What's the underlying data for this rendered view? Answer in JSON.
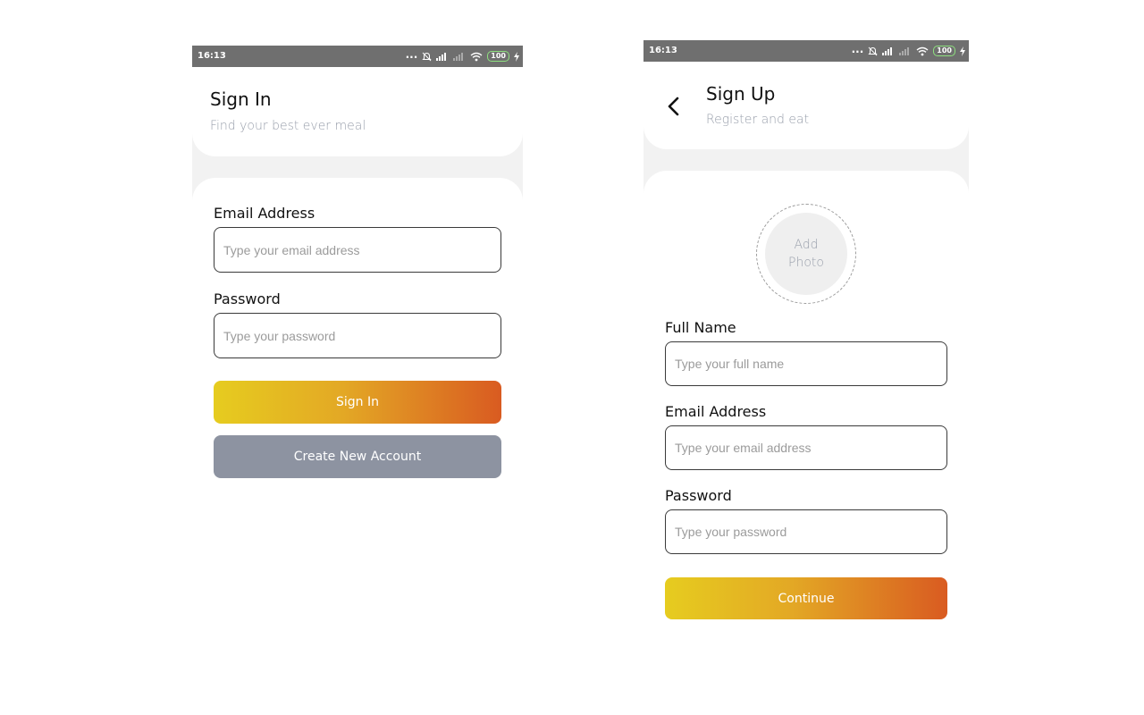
{
  "signin": {
    "status": {
      "time": "16:13",
      "dots": "...",
      "battery": "100"
    },
    "title": "Sign In",
    "subtitle": "Find your best ever meal",
    "email_label": "Email Address",
    "email_placeholder": "Type your email address",
    "email_value": "",
    "password_label": "Password",
    "password_placeholder": "Type your password",
    "password_value": "",
    "signin_button": "Sign In",
    "create_button": "Create New Account"
  },
  "signup": {
    "status": {
      "time": "16:13",
      "dots": "...",
      "battery": "100"
    },
    "title": "Sign Up",
    "subtitle": "Register and eat",
    "add_photo_line1": "Add",
    "add_photo_line2": "Photo",
    "fullname_label": "Full Name",
    "fullname_placeholder": "Type your full name",
    "fullname_value": "",
    "email_label": "Email Address",
    "email_placeholder": "Type your email address",
    "email_value": "",
    "password_label": "Password",
    "password_placeholder": "Type your password",
    "password_value": "",
    "continue_button": "Continue"
  },
  "icons": {
    "back": "chevron-left-icon",
    "alarm_off": "alarm-off-icon",
    "signal": "signal-icon",
    "wifi": "wifi-icon",
    "battery": "battery-icon",
    "charging": "charging-bolt-icon"
  },
  "colors": {
    "gradient_start": "#e6cc1f",
    "gradient_end": "#d95b21",
    "secondary_button": "#8d93a1",
    "status_bar": "#6f6f6f",
    "subtitle": "#9aa0ac",
    "page_background": "#f2f2f2"
  }
}
